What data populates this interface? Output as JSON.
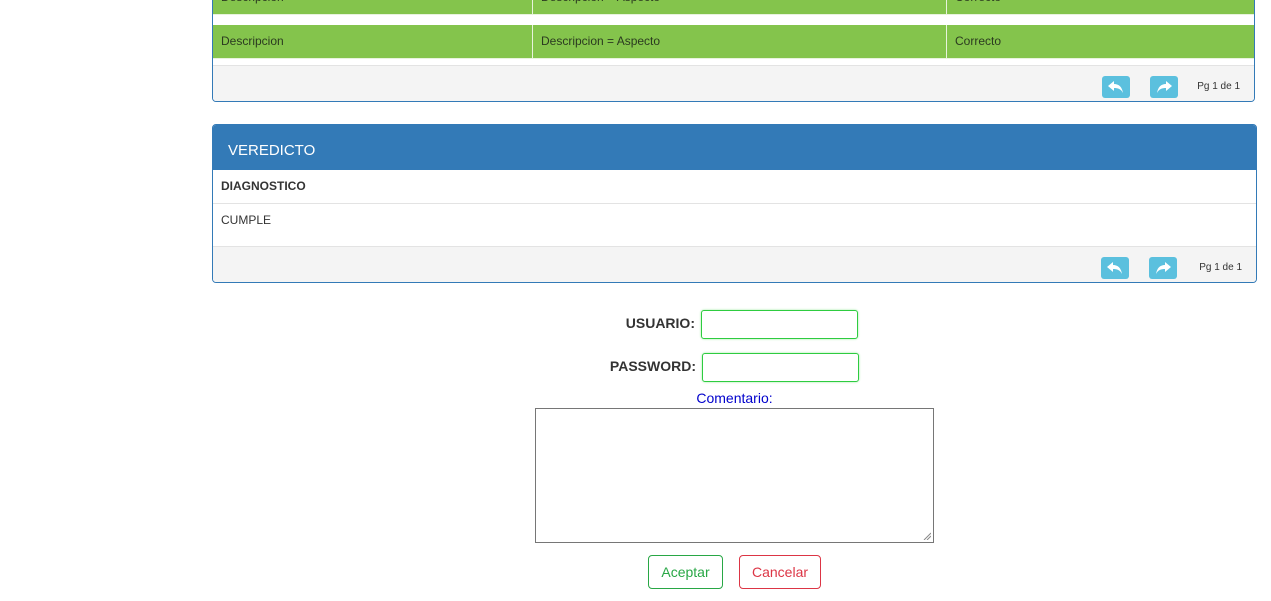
{
  "results_table": {
    "rows": [
      {
        "descripcion": "Descripcion",
        "aspecto": "Descripcion = Aspecto",
        "estado": "Correcto"
      },
      {
        "descripcion": "Descripcion",
        "aspecto": "Descripcion = Aspecto",
        "estado": "Correcto"
      }
    ],
    "page_info": "Pg 1 de 1"
  },
  "veredicto": {
    "title": "VEREDICTO",
    "column_header": "DIAGNOSTICO",
    "value": "CUMPLE",
    "page_info": "Pg 1 de 1"
  },
  "form": {
    "usuario_label": "USUARIO:",
    "password_label": "PASSWORD:",
    "usuario_value": "",
    "password_value": "",
    "comentario_label": "Comentario:",
    "comentario_value": "",
    "accept_label": "Aceptar",
    "cancel_label": "Cancelar"
  },
  "colors": {
    "panel_border": "#337ab7",
    "row_green": "#84c44c",
    "pager_button": "#5bc0de",
    "accept": "#28a745",
    "cancel": "#dc3545",
    "comment_label": "#0000cc"
  },
  "icons": {
    "prev": "undo-arrow-icon",
    "next": "redo-arrow-icon"
  }
}
